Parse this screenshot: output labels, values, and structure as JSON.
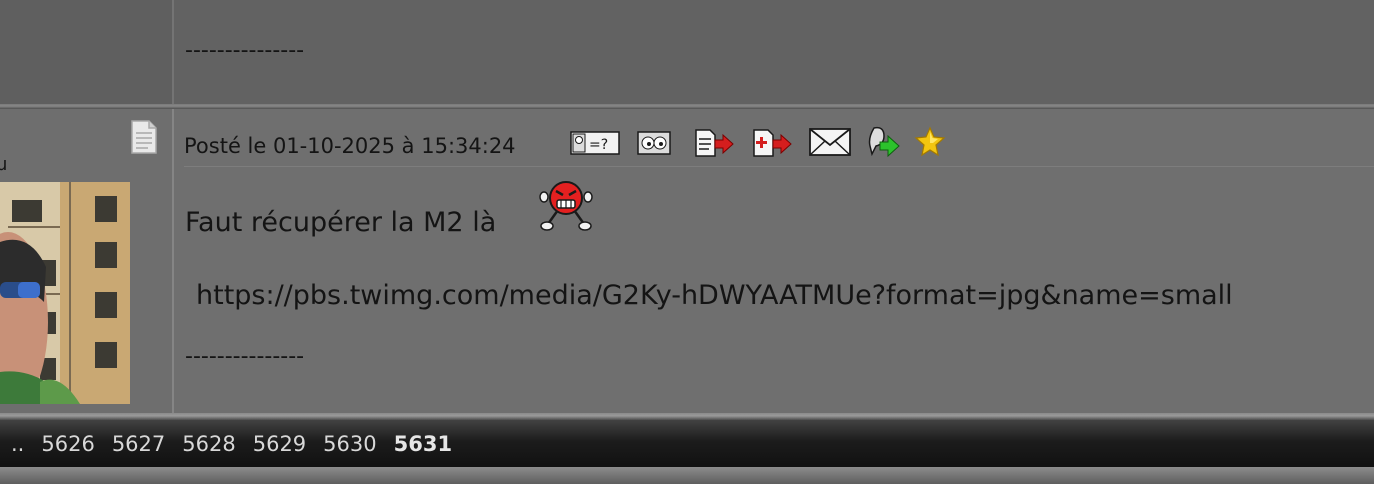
{
  "previous_post": {
    "signature": "---------------"
  },
  "post": {
    "author_tail": "u",
    "date": "Posté le 01-10-2025 à 15:34:24",
    "message": "Faut récupérer la M2 là",
    "link": "https://pbs.twimg.com/media/G2Ky-hDWYAATMUe?format=jpg&name=small",
    "signature": "---------------",
    "smiley": "angry-red-smiley"
  },
  "toolbar": {
    "icons": [
      "profile-quiz-icon",
      "eyes-icon",
      "quote-icon",
      "multi-quote-icon",
      "mail-icon",
      "alert-icon",
      "favorite-star-icon"
    ]
  },
  "pagination": {
    "ellipsis": "..",
    "pages": [
      "5626",
      "5627",
      "5628",
      "5629",
      "5630"
    ],
    "current": "5631"
  }
}
